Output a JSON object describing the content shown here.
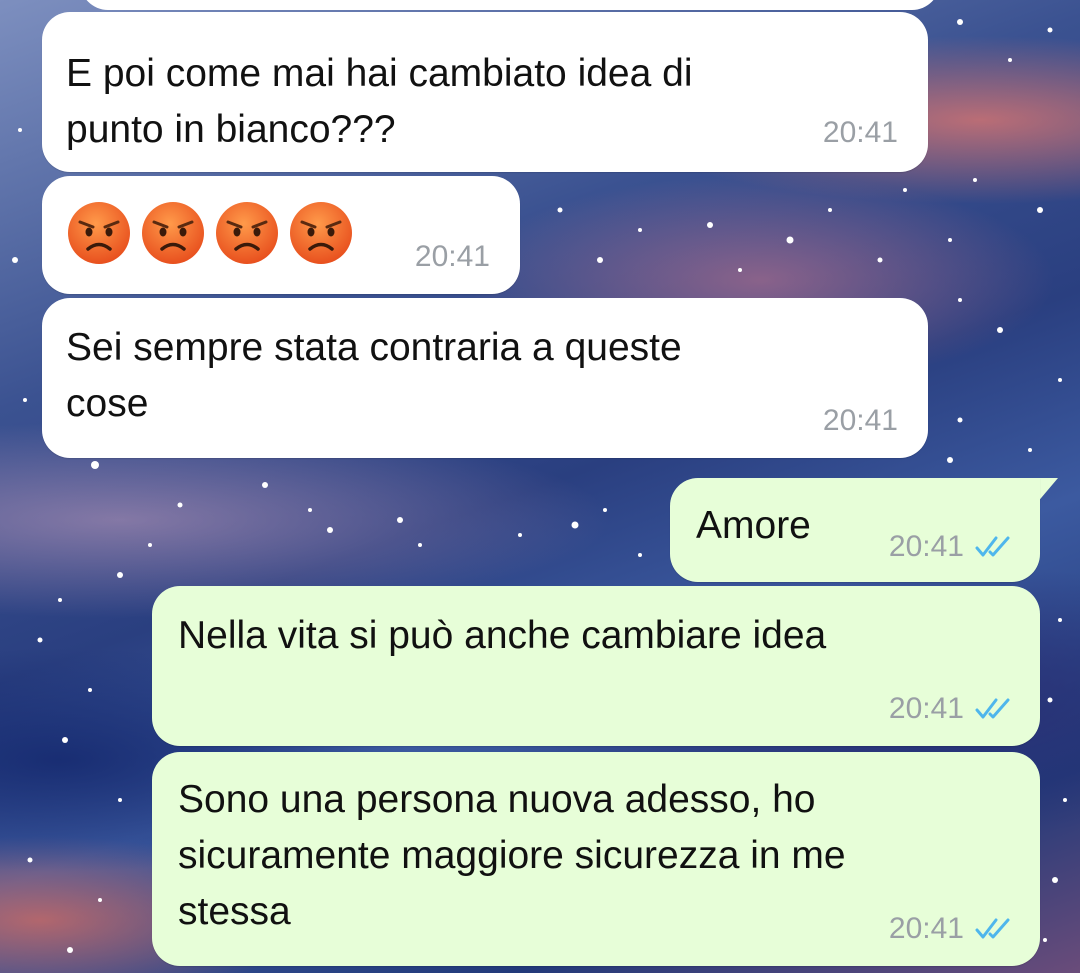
{
  "messages": [
    {
      "direction": "incoming",
      "lines": [
        "E poi come mai hai cambiato idea di",
        "punto in bianco???"
      ],
      "time": "20:41"
    },
    {
      "direction": "incoming",
      "emojis": [
        "pouting-face",
        "pouting-face",
        "pouting-face",
        "pouting-face"
      ],
      "time": "20:41"
    },
    {
      "direction": "incoming",
      "lines": [
        "Sei sempre stata contraria a queste",
        "cose"
      ],
      "time": "20:41"
    },
    {
      "direction": "outgoing",
      "lines": [
        "Amore"
      ],
      "time": "20:41",
      "status": "read-double-check"
    },
    {
      "direction": "outgoing",
      "lines": [
        "Nella vita si può anche cambiare idea"
      ],
      "time": "20:41",
      "status": "read-double-check"
    },
    {
      "direction": "outgoing",
      "lines": [
        "Sono una persona nuova adesso, ho",
        "sicuramente maggiore sicurezza in me",
        "stessa"
      ],
      "time": "20:41",
      "status": "read-double-check"
    }
  ],
  "colors": {
    "incoming_bubble": "#ffffff",
    "outgoing_bubble": "#e7fed8",
    "timestamp": "#9a9fa5",
    "read_ticks": "#4fb6ec",
    "emoji_face": "#f0692a"
  }
}
